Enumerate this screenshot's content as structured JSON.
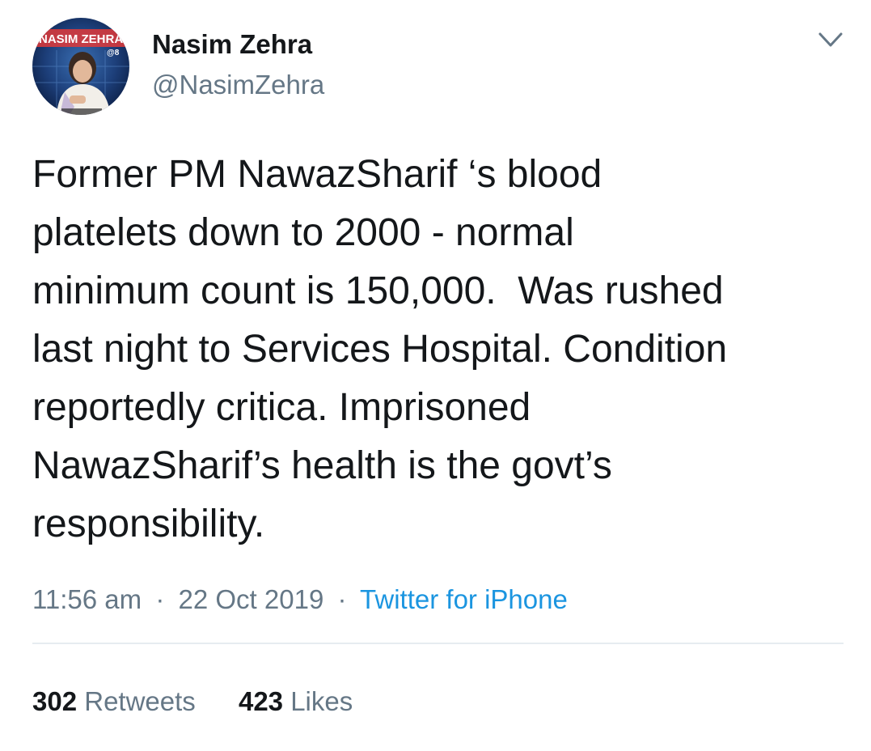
{
  "author": {
    "display_name": "Nasim Zehra",
    "handle": "@NasimZehra",
    "avatar_banner_text": "NASIM ZEHRA",
    "avatar_banner_number": "@8"
  },
  "tweet": {
    "text": "Former PM NawazSharif ‘s blood\nplatelets down to 2000 - normal\nminimum count is 150,000.  Was rushed\nlast night to Services Hospital. Condition\nreportedly critica. Imprisoned\nNawazSharif’s health is the govt’s\nresponsibility."
  },
  "meta": {
    "time": "11:56 am",
    "separator": "·",
    "date": "22 Oct 2019",
    "source": "Twitter for iPhone"
  },
  "stats": {
    "retweets_count": "302",
    "retweets_label": "Retweets",
    "likes_count": "423",
    "likes_label": "Likes"
  },
  "colors": {
    "text": "#14171a",
    "secondary": "#657786",
    "link": "#1b95e0",
    "divider": "#e6ecf0"
  },
  "icons": {
    "more": "chevron-down-icon"
  }
}
